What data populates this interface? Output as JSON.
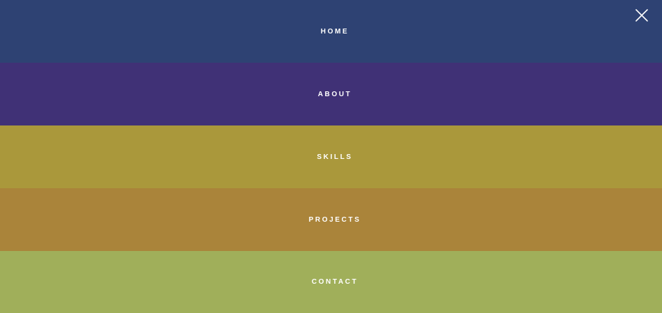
{
  "menu": {
    "items": [
      {
        "label": "HOME",
        "color": "#2e4273"
      },
      {
        "label": "ABOUT",
        "color": "#403176"
      },
      {
        "label": "SKILLS",
        "color": "#aa983b"
      },
      {
        "label": "PROJECTS",
        "color": "#aa843a"
      },
      {
        "label": "CONTACT",
        "color": "#a0af5a"
      }
    ]
  },
  "close_button": {
    "icon": "close-icon",
    "color": "#ffffff"
  }
}
